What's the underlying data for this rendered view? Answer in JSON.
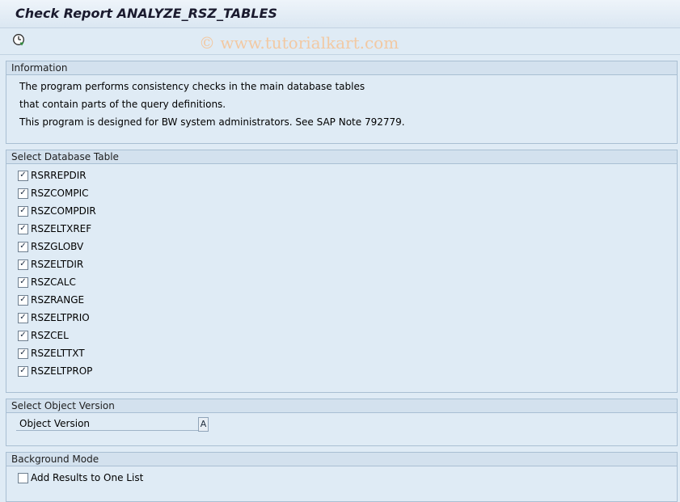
{
  "window": {
    "title": "Check Report ANALYZE_RSZ_TABLES"
  },
  "toolbar": {
    "execute_icon": "clock-execute-icon",
    "watermark": "© www.tutorialkart.com"
  },
  "information": {
    "header": "Information",
    "lines": [
      "The program performs consistency checks in the main database tables",
      "that contain parts of the query definitions.",
      "This program is designed for BW system administrators. See SAP Note 792779."
    ]
  },
  "select_table": {
    "header": "Select Database Table",
    "items": [
      {
        "label": "RSRREPDIR",
        "checked": true
      },
      {
        "label": "RSZCOMPIC",
        "checked": true
      },
      {
        "label": "RSZCOMPDIR",
        "checked": true
      },
      {
        "label": "RSZELTXREF",
        "checked": true
      },
      {
        "label": "RSZGLOBV",
        "checked": true
      },
      {
        "label": "RSZELTDIR",
        "checked": true
      },
      {
        "label": "RSZCALC",
        "checked": true
      },
      {
        "label": "RSZRANGE",
        "checked": true
      },
      {
        "label": "RSZELTPRIO",
        "checked": true
      },
      {
        "label": "RSZCEL",
        "checked": true
      },
      {
        "label": "RSZELTTXT",
        "checked": true
      },
      {
        "label": "RSZELTPROP",
        "checked": true
      }
    ]
  },
  "object_version": {
    "header": "Select Object Version",
    "field_label": "Object Version",
    "value": "A"
  },
  "background": {
    "header": "Background Mode",
    "option_label": "Add Results to One List",
    "checked": false
  },
  "colors": {
    "background": "#dfebf5",
    "group_header": "#d3e1ee",
    "border": "#a9bfd3"
  }
}
